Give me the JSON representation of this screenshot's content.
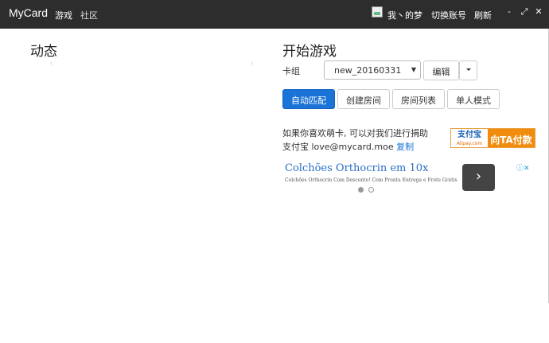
{
  "navbar": {
    "brand": "MyCard",
    "links": [
      "游戏",
      "社区"
    ],
    "user": "我丶的梦",
    "switch_account": "切换账号",
    "refresh": "刷新",
    "window": {
      "minimize": "-",
      "maximize": "⤢",
      "close": "✕"
    }
  },
  "news": {
    "title": "动态",
    "prev": "‹",
    "next": "›"
  },
  "game": {
    "title": "开始游戏",
    "deck_label": "卡组",
    "deck_value": "new_20160331",
    "edit_label": "编辑",
    "buttons": {
      "auto_match": "自动匹配",
      "create_room": "创建房间",
      "room_list": "房间列表",
      "single": "单人模式"
    }
  },
  "donate": {
    "line1": "如果你喜欢萌卡, 可以对我们进行捐助",
    "line2_prefix": "支付宝 love@mycard.moe",
    "copy": "复制",
    "alipay_logo": "支付宝",
    "alipay_domain": "Alipay.com",
    "alipay_pay": "向TA付款"
  },
  "ad": {
    "title": "Colchões Orthocrin em 10x",
    "subtitle": "Colchões Orthocrin Com Desconto! Com Pronta Entrega e Frete Grátis",
    "next": "›",
    "info": "ⓘ✕"
  }
}
